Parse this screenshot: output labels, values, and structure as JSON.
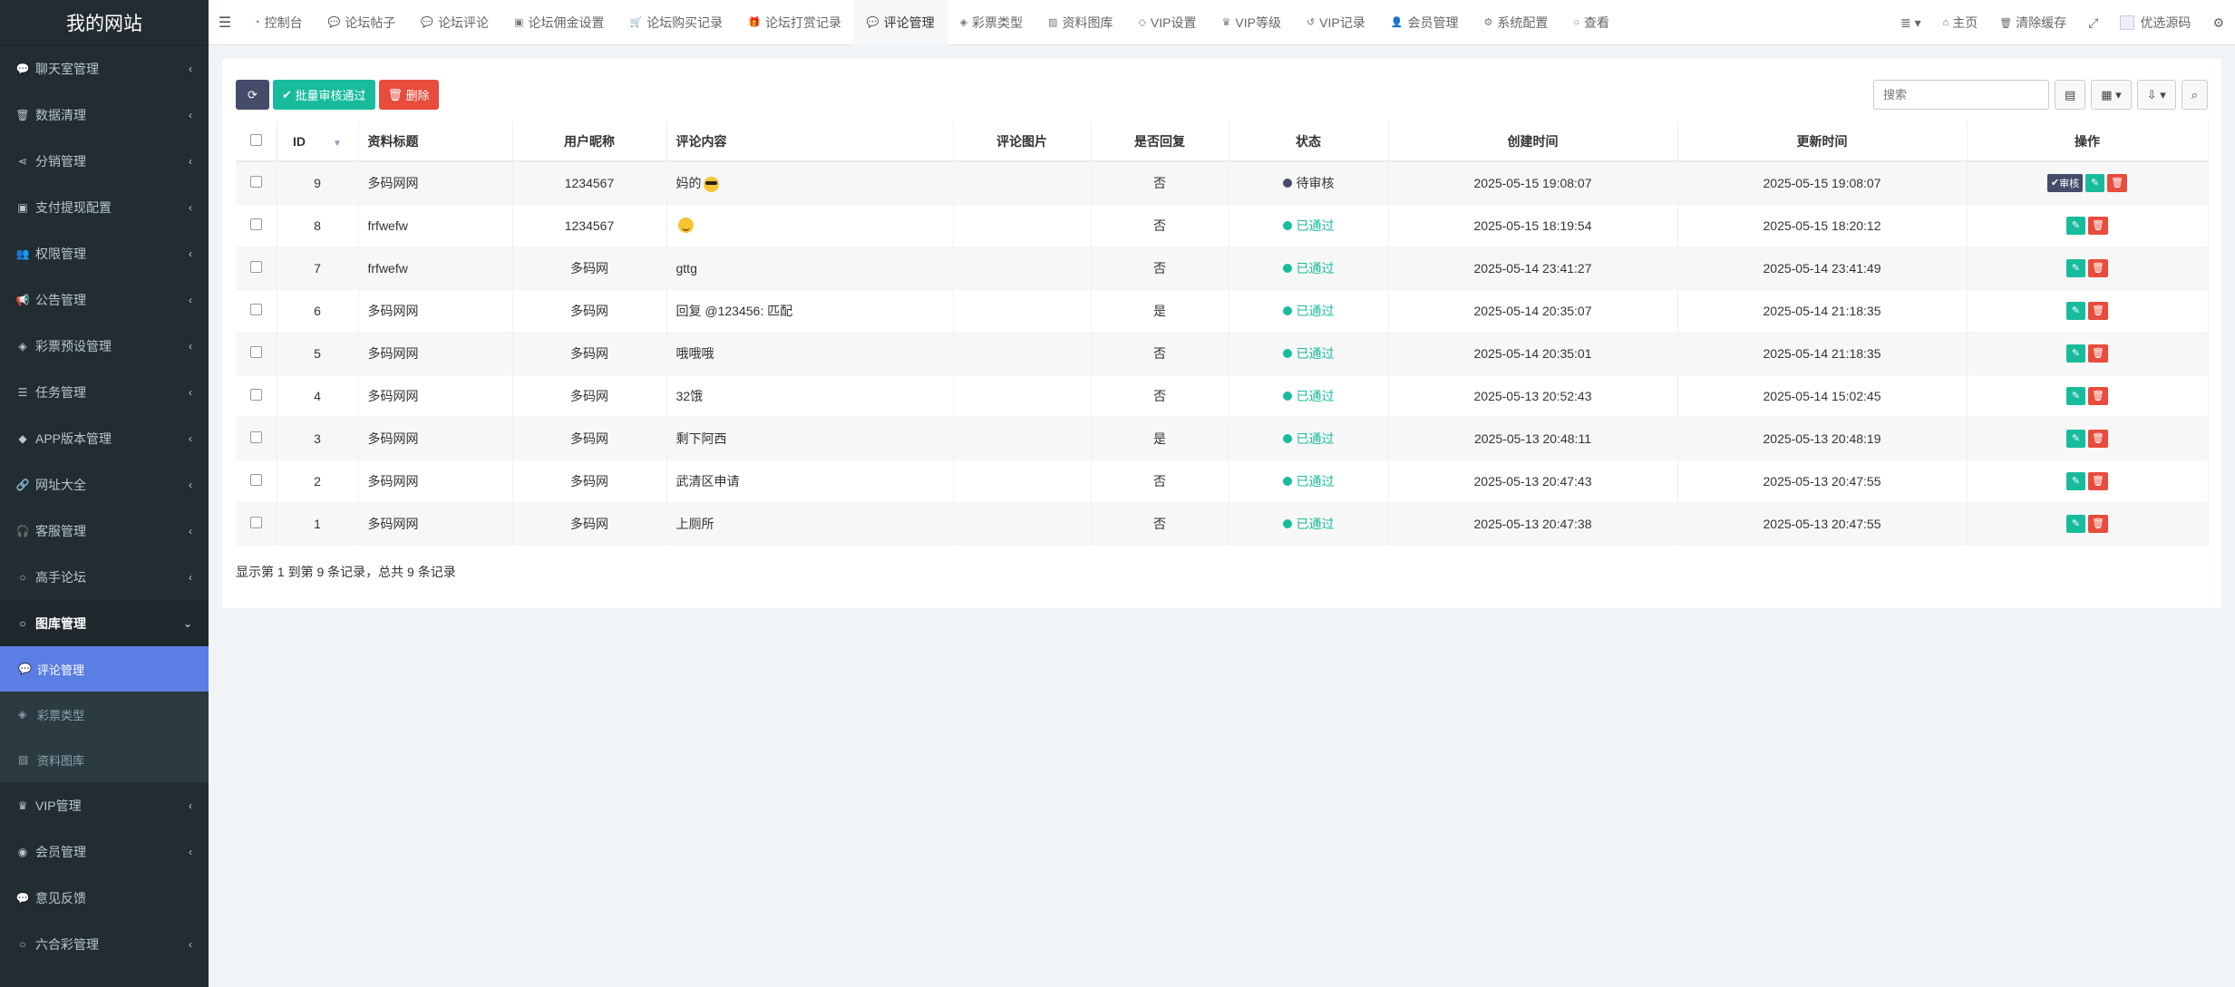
{
  "sidebar": {
    "logo": "我的网站",
    "items": [
      {
        "label": "聊天室管理",
        "icon": "chat-icon"
      },
      {
        "label": "数据清理",
        "icon": "trash-icon"
      },
      {
        "label": "分销管理",
        "icon": "share-icon"
      },
      {
        "label": "支付提现配置",
        "icon": "money-icon"
      },
      {
        "label": "权限管理",
        "icon": "users-icon"
      },
      {
        "label": "公告管理",
        "icon": "bullhorn-icon"
      },
      {
        "label": "彩票预设管理",
        "icon": "ticket-icon"
      },
      {
        "label": "任务管理",
        "icon": "list-icon"
      },
      {
        "label": "APP版本管理",
        "icon": "app-icon"
      },
      {
        "label": "网址大全",
        "icon": "link-icon"
      },
      {
        "label": "客服管理",
        "icon": "headset-icon"
      },
      {
        "label": "高手论坛",
        "icon": "circle-icon"
      },
      {
        "label": "图库管理",
        "icon": "circle-icon"
      }
    ],
    "submenu": [
      {
        "label": "评论管理",
        "icon": "comments-icon"
      },
      {
        "label": "彩票类型",
        "icon": "ticket-icon"
      },
      {
        "label": "资料图库",
        "icon": "image-icon"
      }
    ],
    "bottom_items": [
      {
        "label": "VIP管理",
        "icon": "vip-icon"
      },
      {
        "label": "会员管理",
        "icon": "user-circle-icon"
      },
      {
        "label": "意见反馈",
        "icon": "comment-icon"
      },
      {
        "label": "六合彩管理",
        "icon": "circle-icon"
      }
    ]
  },
  "topbar": {
    "tabs": [
      {
        "label": "控制台",
        "icon": "dashboard-icon"
      },
      {
        "label": "论坛帖子",
        "icon": "comment-icon"
      },
      {
        "label": "论坛评论",
        "icon": "comments-icon"
      },
      {
        "label": "论坛佣金设置",
        "icon": "money-icon"
      },
      {
        "label": "论坛购买记录",
        "icon": "cart-icon"
      },
      {
        "label": "论坛打赏记录",
        "icon": "gift-icon"
      },
      {
        "label": "评论管理",
        "icon": "comments-icon"
      },
      {
        "label": "彩票类型",
        "icon": "ticket-icon"
      },
      {
        "label": "资料图库",
        "icon": "image-icon"
      },
      {
        "label": "VIP设置",
        "icon": "diamond-icon"
      },
      {
        "label": "VIP等级",
        "icon": "vip-icon"
      },
      {
        "label": "VIP记录",
        "icon": "history-icon"
      },
      {
        "label": "会员管理",
        "icon": "user-icon"
      },
      {
        "label": "系统配置",
        "icon": "gear-icon"
      },
      {
        "label": "查看",
        "icon": "circle-icon"
      }
    ],
    "right": {
      "home": "主页",
      "clear_cache": "清除缓存",
      "user": "优选源码"
    }
  },
  "toolbar": {
    "approve_label": "批量审核通过",
    "delete_label": "删除",
    "search_placeholder": "搜索"
  },
  "table": {
    "headers": [
      "ID",
      "资料标题",
      "用户昵称",
      "评论内容",
      "评论图片",
      "是否回复",
      "状态",
      "创建时间",
      "更新时间",
      "操作"
    ],
    "audit_label": "审核",
    "rows": [
      {
        "id": "9",
        "title": "多码网网",
        "nick": "1234567",
        "content": "妈的",
        "emoji": "cool",
        "reply": "否",
        "status": "待审核",
        "status_type": "pending",
        "created": "2025-05-15 19:08:07",
        "updated": "2025-05-15 19:08:07"
      },
      {
        "id": "8",
        "title": "frfwefw",
        "nick": "1234567",
        "content": "",
        "emoji": "smile",
        "reply": "否",
        "status": "已通过",
        "status_type": "pass",
        "created": "2025-05-15 18:19:54",
        "updated": "2025-05-15 18:20:12"
      },
      {
        "id": "7",
        "title": "frfwefw",
        "nick": "多码网",
        "content": "gttg",
        "emoji": "",
        "reply": "否",
        "status": "已通过",
        "status_type": "pass",
        "created": "2025-05-14 23:41:27",
        "updated": "2025-05-14 23:41:49"
      },
      {
        "id": "6",
        "title": "多码网网",
        "nick": "多码网",
        "content": "回复 @123456: 匹配",
        "emoji": "",
        "reply": "是",
        "status": "已通过",
        "status_type": "pass",
        "created": "2025-05-14 20:35:07",
        "updated": "2025-05-14 21:18:35"
      },
      {
        "id": "5",
        "title": "多码网网",
        "nick": "多码网",
        "content": "哦哦哦",
        "emoji": "",
        "reply": "否",
        "status": "已通过",
        "status_type": "pass",
        "created": "2025-05-14 20:35:01",
        "updated": "2025-05-14 21:18:35"
      },
      {
        "id": "4",
        "title": "多码网网",
        "nick": "多码网",
        "content": "32饿",
        "emoji": "",
        "reply": "否",
        "status": "已通过",
        "status_type": "pass",
        "created": "2025-05-13 20:52:43",
        "updated": "2025-05-14 15:02:45"
      },
      {
        "id": "3",
        "title": "多码网网",
        "nick": "多码网",
        "content": "剩下阿西",
        "emoji": "",
        "reply": "是",
        "status": "已通过",
        "status_type": "pass",
        "created": "2025-05-13 20:48:11",
        "updated": "2025-05-13 20:48:19"
      },
      {
        "id": "2",
        "title": "多码网网",
        "nick": "多码网",
        "content": "武清区申请",
        "emoji": "",
        "reply": "否",
        "status": "已通过",
        "status_type": "pass",
        "created": "2025-05-13 20:47:43",
        "updated": "2025-05-13 20:47:55"
      },
      {
        "id": "1",
        "title": "多码网网",
        "nick": "多码网",
        "content": "上厕所",
        "emoji": "",
        "reply": "否",
        "status": "已通过",
        "status_type": "pass",
        "created": "2025-05-13 20:47:38",
        "updated": "2025-05-13 20:47:55"
      }
    ]
  },
  "pager": {
    "info": "显示第 1 到第 9 条记录，总共 9 条记录"
  },
  "colors": {
    "sidebar_bg": "#222d32",
    "active_sub": "#5b7ee5",
    "success": "#18bc9c",
    "danger": "#e74c3c",
    "primary_dark": "#444c69"
  }
}
